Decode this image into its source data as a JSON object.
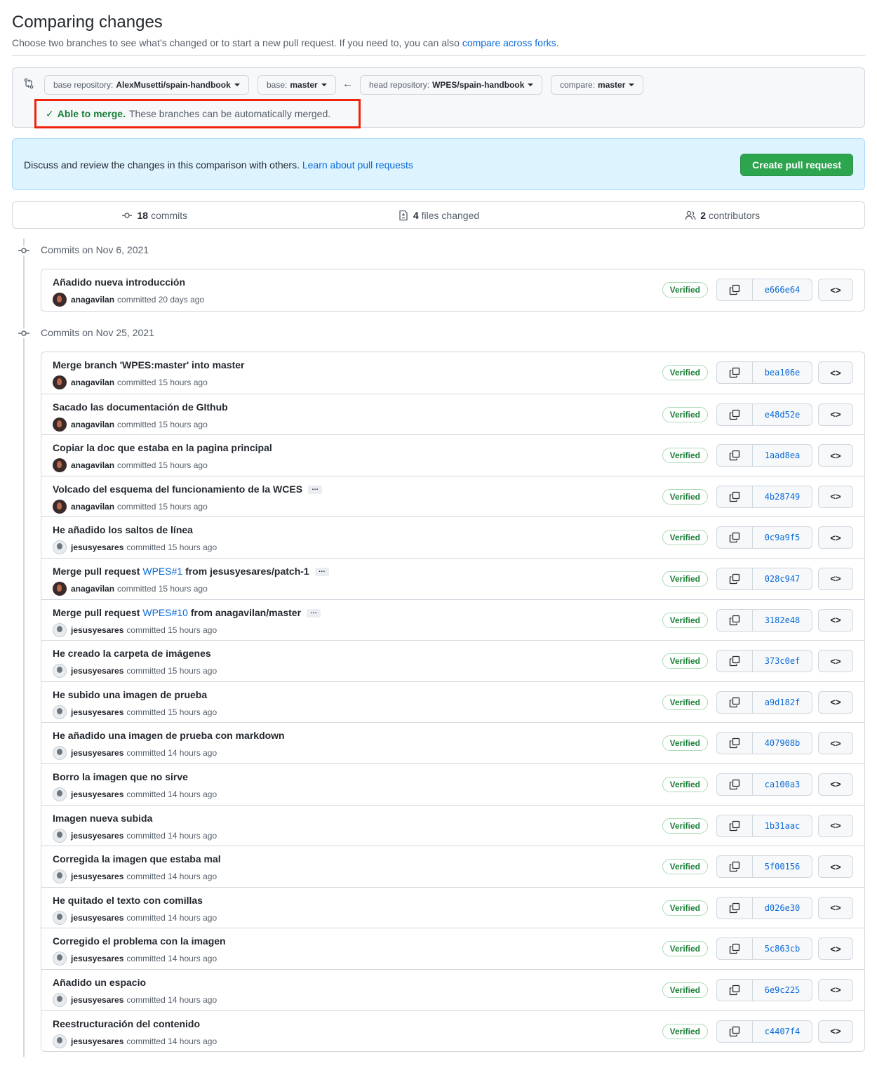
{
  "header": {
    "title": "Comparing changes",
    "subtitle": "Choose two branches to see what’s changed or to start a new pull request. If you need to, you can also",
    "compare_link": "compare across forks",
    "subtitle_end": "."
  },
  "range": {
    "base_repo_label": "base repository:",
    "base_repo_value": "AlexMusetti/spain-handbook",
    "base_label": "base:",
    "base_value": "master",
    "head_repo_label": "head repository:",
    "head_repo_value": "WPES/spain-handbook",
    "compare_label": "compare:",
    "compare_value": "master",
    "merge_check": "✓",
    "merge_ok": "Able to merge.",
    "merge_msg": "These branches can be automatically merged.",
    "arrow": "←"
  },
  "banner": {
    "message": "Discuss and review the changes in this comparison with others.",
    "link": "Learn about pull requests",
    "button": "Create pull request"
  },
  "stats": {
    "commits_count": "18",
    "commits_label": "commits",
    "files_count": "4",
    "files_label": "files changed",
    "contributors_count": "2",
    "contributors_label": "contributors"
  },
  "groups": [
    {
      "date": "Commits on Nov 6, 2021",
      "commits": [
        {
          "title": "Añadido nueva introducción",
          "author": "anagavilan",
          "time": "committed 20 days ago",
          "sha": "e666e64",
          "avatar": "dark"
        }
      ]
    },
    {
      "date": "Commits on Nov 25, 2021",
      "commits": [
        {
          "title": "Merge branch 'WPES:master' into master",
          "author": "anagavilan",
          "time": "committed 15 hours ago",
          "sha": "bea106e",
          "avatar": "dark"
        },
        {
          "title": "Sacado las documentación de GIthub",
          "author": "anagavilan",
          "time": "committed 15 hours ago",
          "sha": "e48d52e",
          "avatar": "dark"
        },
        {
          "title": "Copiar la doc que estaba en la pagina principal",
          "author": "anagavilan",
          "time": "committed 15 hours ago",
          "sha": "1aad8ea",
          "avatar": "dark"
        },
        {
          "title": "Volcado del esquema del funcionamiento de la WCES",
          "author": "anagavilan",
          "time": "committed 15 hours ago",
          "sha": "4b28749",
          "avatar": "dark",
          "ellipsis": true
        },
        {
          "title": "He añadido los saltos de línea",
          "author": "jesusyesares",
          "time": "committed 15 hours ago",
          "sha": "0c9a9f5",
          "avatar": "light"
        },
        {
          "title": "Merge pull request",
          "pr": "WPES#1",
          "title_end": "from jesusyesares/patch-1",
          "author": "anagavilan",
          "time": "committed 15 hours ago",
          "sha": "028c947",
          "avatar": "dark",
          "ellipsis": true
        },
        {
          "title": "Merge pull request",
          "pr": "WPES#10",
          "title_end": "from anagavilan/master",
          "author": "jesusyesares",
          "time": "committed 15 hours ago",
          "sha": "3182e48",
          "avatar": "light",
          "ellipsis": true
        },
        {
          "title": "He creado la carpeta de imágenes",
          "author": "jesusyesares",
          "time": "committed 15 hours ago",
          "sha": "373c0ef",
          "avatar": "light"
        },
        {
          "title": "He subido una imagen de prueba",
          "author": "jesusyesares",
          "time": "committed 15 hours ago",
          "sha": "a9d182f",
          "avatar": "light"
        },
        {
          "title": "He añadido una imagen de prueba con markdown",
          "author": "jesusyesares",
          "time": "committed 14 hours ago",
          "sha": "407908b",
          "avatar": "light"
        },
        {
          "title": "Borro la imagen que no sirve",
          "author": "jesusyesares",
          "time": "committed 14 hours ago",
          "sha": "ca100a3",
          "avatar": "light"
        },
        {
          "title": "Imagen nueva subida",
          "author": "jesusyesares",
          "time": "committed 14 hours ago",
          "sha": "1b31aac",
          "avatar": "light"
        },
        {
          "title": "Corregida la imagen que estaba mal",
          "author": "jesusyesares",
          "time": "committed 14 hours ago",
          "sha": "5f00156",
          "avatar": "light"
        },
        {
          "title": "He quitado el texto con comillas",
          "author": "jesusyesares",
          "time": "committed 14 hours ago",
          "sha": "d026e30",
          "avatar": "light"
        },
        {
          "title": "Corregido el problema con la imagen",
          "author": "jesusyesares",
          "time": "committed 14 hours ago",
          "sha": "5c863cb",
          "avatar": "light"
        },
        {
          "title": "Añadido un espacio",
          "author": "jesusyesares",
          "time": "committed 14 hours ago",
          "sha": "6e9c225",
          "avatar": "light"
        },
        {
          "title": "Reestructuración del contenido",
          "author": "jesusyesares",
          "time": "committed 14 hours ago",
          "sha": "c4407f4",
          "avatar": "light"
        }
      ]
    }
  ],
  "labels": {
    "verified": "Verified",
    "ellipsis": "…",
    "code": "<>"
  },
  "colors": {
    "accent_link": "#0969da",
    "success": "#1a7f37",
    "button_green": "#2da44e",
    "highlight_red": "#f0230f",
    "banner_bg": "#ddf4ff"
  }
}
